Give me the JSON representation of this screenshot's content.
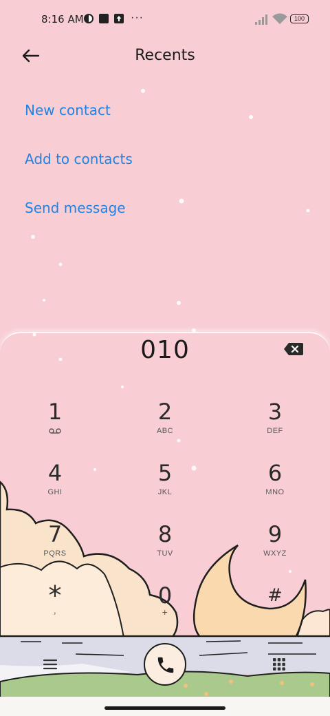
{
  "status_bar": {
    "time": "8:16 AM",
    "more_label": "···",
    "battery": "100"
  },
  "header": {
    "title": "Recents"
  },
  "actions": [
    {
      "label": "New contact"
    },
    {
      "label": "Add to contacts"
    },
    {
      "label": "Send message"
    }
  ],
  "dialer": {
    "number": "010",
    "keys": [
      {
        "digit": "1",
        "letters": ""
      },
      {
        "digit": "2",
        "letters": "ABC"
      },
      {
        "digit": "3",
        "letters": "DEF"
      },
      {
        "digit": "4",
        "letters": "GHI"
      },
      {
        "digit": "5",
        "letters": "JKL"
      },
      {
        "digit": "6",
        "letters": "MNO"
      },
      {
        "digit": "7",
        "letters": "PQRS"
      },
      {
        "digit": "8",
        "letters": "TUV"
      },
      {
        "digit": "9",
        "letters": "WXYZ"
      },
      {
        "digit": "*",
        "letters": ","
      },
      {
        "digit": "0",
        "letters": "+"
      },
      {
        "digit": "#",
        "letters": ""
      }
    ]
  },
  "icons": {
    "back": "arrow-left-icon",
    "backspace": "backspace-icon",
    "voicemail": "voicemail-icon",
    "menu": "menu-icon",
    "call": "phone-icon",
    "keypad": "dialpad-icon"
  },
  "colors": {
    "background": "#f8cdd4",
    "link": "#1e84e6",
    "call_button": "#fbeee0"
  }
}
